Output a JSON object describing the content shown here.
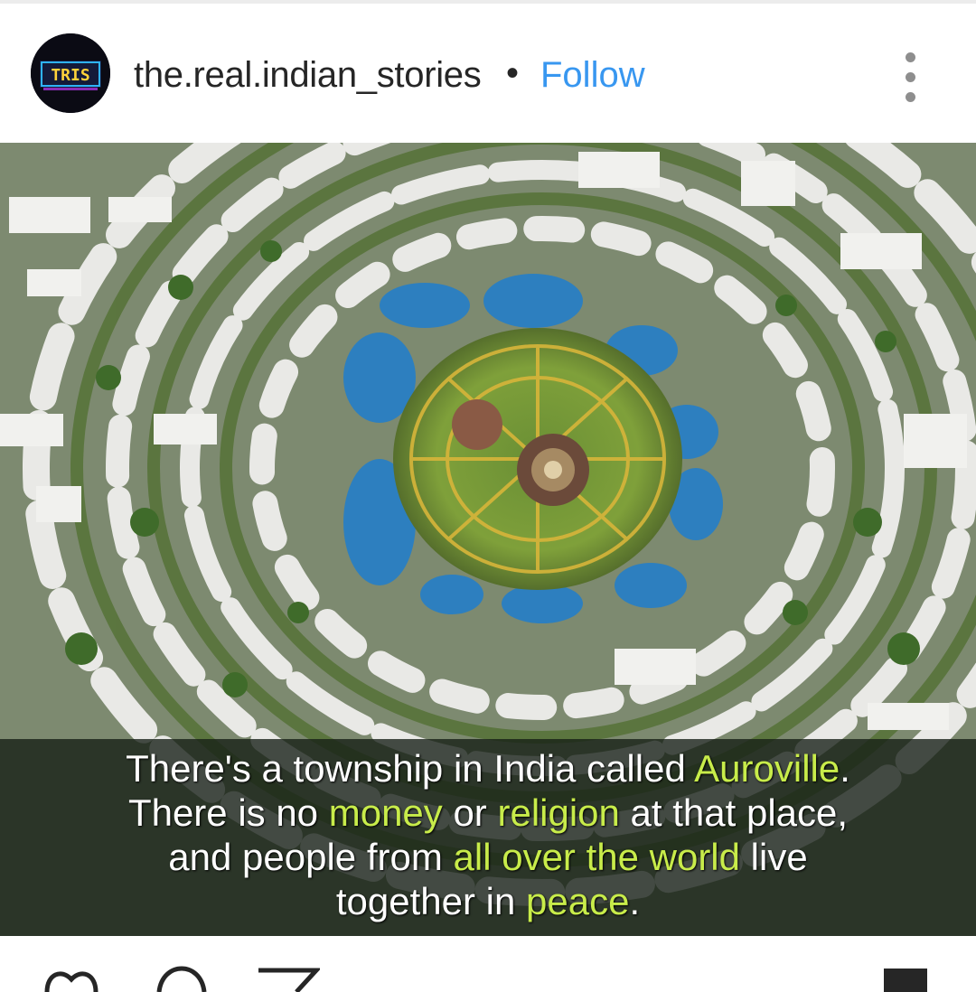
{
  "post": {
    "username": "the.real.indian_stories",
    "separator": "•",
    "follow_label": "Follow",
    "avatar_text": "TRIS"
  },
  "image_caption": {
    "line1_a": "There's a township in India called ",
    "line1_b": "Auroville",
    "line1_c": ".",
    "line2_a": "There is no ",
    "line2_b": "money",
    "line2_c": " or ",
    "line2_d": "religion",
    "line2_e": " at that place,",
    "line3_a": "and people from ",
    "line3_b": "all over the world",
    "line3_c": " live",
    "line4_a": "together in ",
    "line4_b": "peace",
    "line4_c": "."
  },
  "icons": {
    "more": "more-vertical-icon",
    "like": "heart-icon",
    "comment": "comment-icon",
    "share": "share-icon",
    "save": "bookmark-icon"
  },
  "colors": {
    "follow": "#3897f0",
    "highlight": "#c8ec4a",
    "text": "#262626"
  }
}
